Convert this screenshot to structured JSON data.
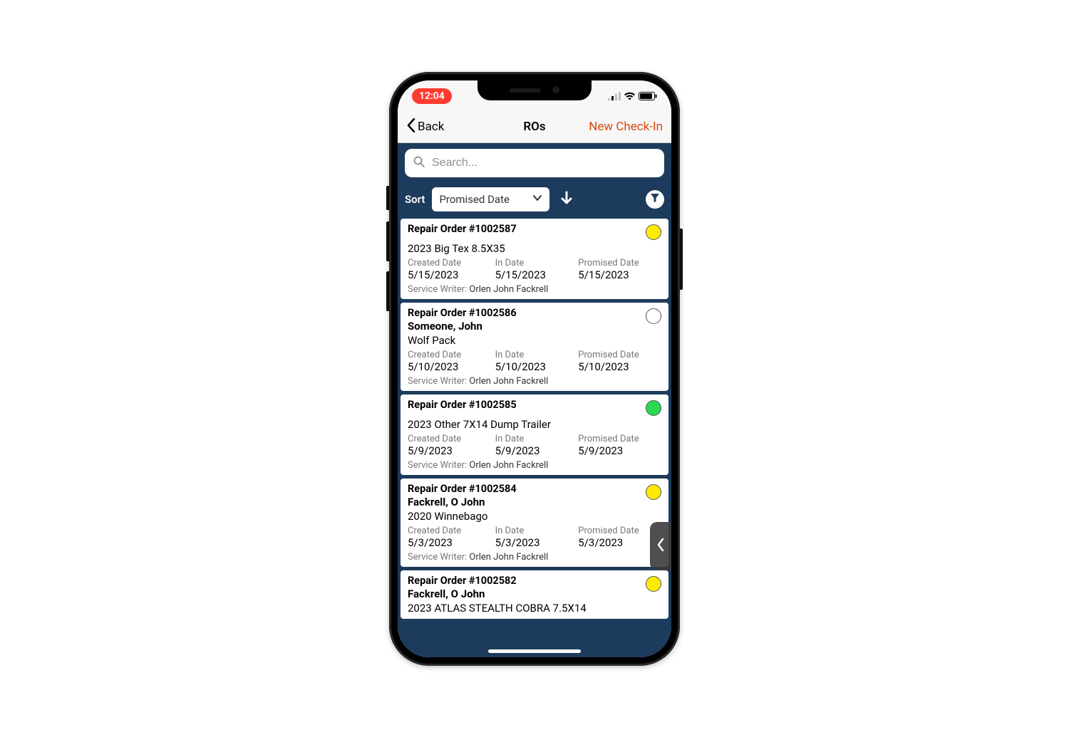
{
  "status": {
    "time": "12:04"
  },
  "nav": {
    "back": "Back",
    "title": "ROs",
    "action": "New Check-In"
  },
  "search": {
    "placeholder": "Search..."
  },
  "sort": {
    "label": "Sort",
    "selected": "Promised Date"
  },
  "labels": {
    "created": "Created Date",
    "in": "In Date",
    "promised": "Promised Date",
    "service_writer": "Service Writer:"
  },
  "orders": [
    {
      "title": "Repair Order #1002587",
      "customer": "",
      "vehicle": "2023 Big Tex 8.5X35",
      "created": "5/15/2023",
      "in": "5/15/2023",
      "promised": "5/15/2023",
      "writer": "Orlen John Fackrell",
      "status_color": "#ffeb00"
    },
    {
      "title": "Repair Order #1002586",
      "customer": "Someone, John",
      "vehicle": "Wolf Pack",
      "created": "5/10/2023",
      "in": "5/10/2023",
      "promised": "5/10/2023",
      "writer": "Orlen John Fackrell",
      "status_color": "#ffffff"
    },
    {
      "title": "Repair Order #1002585",
      "customer": "",
      "vehicle": "2023 Other 7X14 Dump Trailer",
      "created": "5/9/2023",
      "in": "5/9/2023",
      "promised": "5/9/2023",
      "writer": "Orlen John Fackrell",
      "status_color": "#2bd955"
    },
    {
      "title": "Repair Order #1002584",
      "customer": "Fackrell, O John",
      "vehicle": "2020 Winnebago",
      "created": "5/3/2023",
      "in": "5/3/2023",
      "promised": "5/3/2023",
      "writer": "Orlen John Fackrell",
      "status_color": "#ffeb00"
    },
    {
      "title": "Repair Order #1002582",
      "customer": "Fackrell, O John",
      "vehicle": "2023 ATLAS STEALTH COBRA 7.5X14",
      "created": "",
      "in": "",
      "promised": "",
      "writer": "",
      "status_color": "#ffeb00"
    }
  ]
}
